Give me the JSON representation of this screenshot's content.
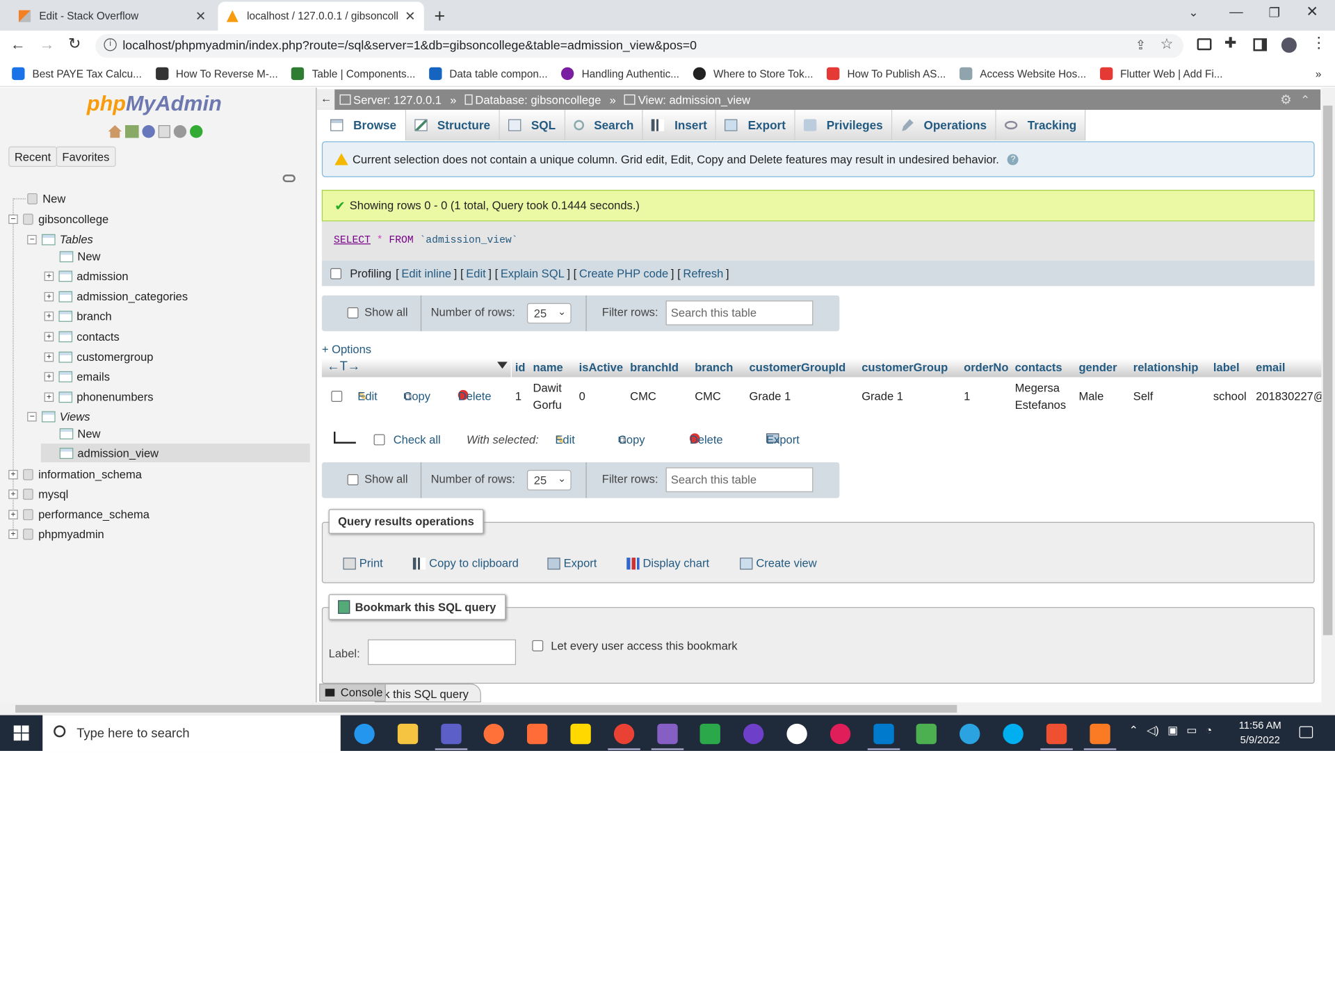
{
  "browser": {
    "tabs": [
      {
        "title": "Edit - Stack Overflow"
      },
      {
        "title": "localhost / 127.0.0.1 / gibsoncolle"
      }
    ],
    "address": "localhost/phpmyadmin/index.php?route=/sql&server=1&db=gibsoncollege&table=admission_view&pos=0",
    "bookmarks": [
      {
        "label": "Best PAYE Tax Calcu...",
        "color": "#1a73e8"
      },
      {
        "label": "How To Reverse M-...",
        "color": "#333333"
      },
      {
        "label": "Table | Components...",
        "color": "#2e7d32"
      },
      {
        "label": "Data table compon...",
        "color": "#1565c0"
      },
      {
        "label": "Handling Authentic...",
        "color": "#7b1fa2"
      },
      {
        "label": "Where to Store Tok...",
        "color": "#222222"
      },
      {
        "label": "How To Publish AS...",
        "color": "#e53935"
      },
      {
        "label": "Access Website Hos...",
        "color": "#90a4ae"
      },
      {
        "label": "Flutter Web | Add Fi...",
        "color": "#e53935"
      }
    ],
    "overflow": "»"
  },
  "left": {
    "logo_a": "php",
    "logo_b": "MyAdmin",
    "recent": "Recent",
    "favorites": "Favorites",
    "tree": {
      "new": "New",
      "db": "gibsoncollege",
      "tables_label": "Tables",
      "tables_new": "New",
      "tables": [
        "admission",
        "admission_categories",
        "branch",
        "contacts",
        "customergroup",
        "emails",
        "phonenumbers"
      ],
      "views_label": "Views",
      "views_new": "New",
      "views": [
        "admission_view"
      ],
      "other_dbs": [
        "information_schema",
        "mysql",
        "performance_schema",
        "phpmyadmin"
      ]
    }
  },
  "main": {
    "breadcrumb": {
      "server": "Server: 127.0.0.1",
      "database": "Database: gibsoncollege",
      "view": "View: admission_view",
      "sep": "»"
    },
    "tabs": [
      "Browse",
      "Structure",
      "SQL",
      "Search",
      "Insert",
      "Export",
      "Privileges",
      "Operations",
      "Tracking"
    ],
    "warning": "Current selection does not contain a unique column. Grid edit, Edit, Copy and Delete features may result in undesired behavior.",
    "success": "Showing rows 0 - 0 (1 total, Query took 0.1444 seconds.)",
    "sql": {
      "kw1": "SELECT",
      "star": "*",
      "kw2": "FROM",
      "table": "`admission_view`"
    },
    "profiling": {
      "label": "Profiling",
      "links": [
        "Edit inline",
        "Edit",
        "Explain SQL",
        "Create PHP code",
        "Refresh"
      ]
    },
    "nav": {
      "show_all": "Show all",
      "num_rows_label": "Number of rows:",
      "num_rows": "25",
      "filter_label": "Filter rows:",
      "filter_placeholder": "Search this table"
    },
    "options": "+ Options",
    "columns": [
      "id",
      "name",
      "isActive",
      "branchId",
      "branch",
      "customerGroupId",
      "customerGroup",
      "orderNo",
      "contacts",
      "gender",
      "relationship",
      "label",
      "email"
    ],
    "row": {
      "edit": "Edit",
      "copy": "Copy",
      "delete": "Delete",
      "id": "1",
      "name_1": "Dawit",
      "name_2": "Gorfu",
      "isActive": "0",
      "branchId": "CMC",
      "branch": "CMC",
      "customerGroupId": "Grade 1",
      "customerGroup": "Grade 1",
      "orderNo": "1",
      "contacts_1": "Megersa",
      "contacts_2": "Estefanos",
      "gender": "Male",
      "relationship": "Self",
      "label": "school",
      "email": "201830227@"
    },
    "withsel": {
      "check_all": "Check all",
      "with_selected": "With selected:",
      "edit": "Edit",
      "copy": "Copy",
      "delete": "Delete",
      "export": "Export"
    },
    "qro": {
      "legend": "Query results operations",
      "print": "Print",
      "copy": "Copy to clipboard",
      "export": "Export",
      "chart": "Display chart",
      "view": "Create view"
    },
    "bookmark": {
      "legend": "Bookmark this SQL query",
      "label": "Label:",
      "let_every": "Let every user access this bookmark",
      "tail": "k this SQL query"
    },
    "console": "Console"
  },
  "taskbar": {
    "search": "Type here to search",
    "time": "11:56 AM",
    "date": "5/9/2022",
    "apps": [
      {
        "name": "docker",
        "color": "#2496ed"
      },
      {
        "name": "file-explorer",
        "color": "#f5c542"
      },
      {
        "name": "teams",
        "color": "#5b5fc7"
      },
      {
        "name": "firefox",
        "color": "#ff7139"
      },
      {
        "name": "postman",
        "color": "#ff6c37"
      },
      {
        "name": "sticky-notes",
        "color": "#ffd800"
      },
      {
        "name": "chrome",
        "color": "#e94235"
      },
      {
        "name": "visual-studio",
        "color": "#865fc5"
      },
      {
        "name": "excel-app",
        "color": "#2aa84a"
      },
      {
        "name": "github",
        "color": "#6e40c9"
      },
      {
        "name": "word-app",
        "color": "#ffffff"
      },
      {
        "name": "slack",
        "color": "#e01e5a"
      },
      {
        "name": "vscode",
        "color": "#007acc"
      },
      {
        "name": "notepad-app",
        "color": "#4caf50"
      },
      {
        "name": "telegram",
        "color": "#2aa3e0"
      },
      {
        "name": "skype",
        "color": "#00aff0"
      },
      {
        "name": "git",
        "color": "#f05032"
      },
      {
        "name": "xampp",
        "color": "#fb7a24"
      }
    ]
  }
}
